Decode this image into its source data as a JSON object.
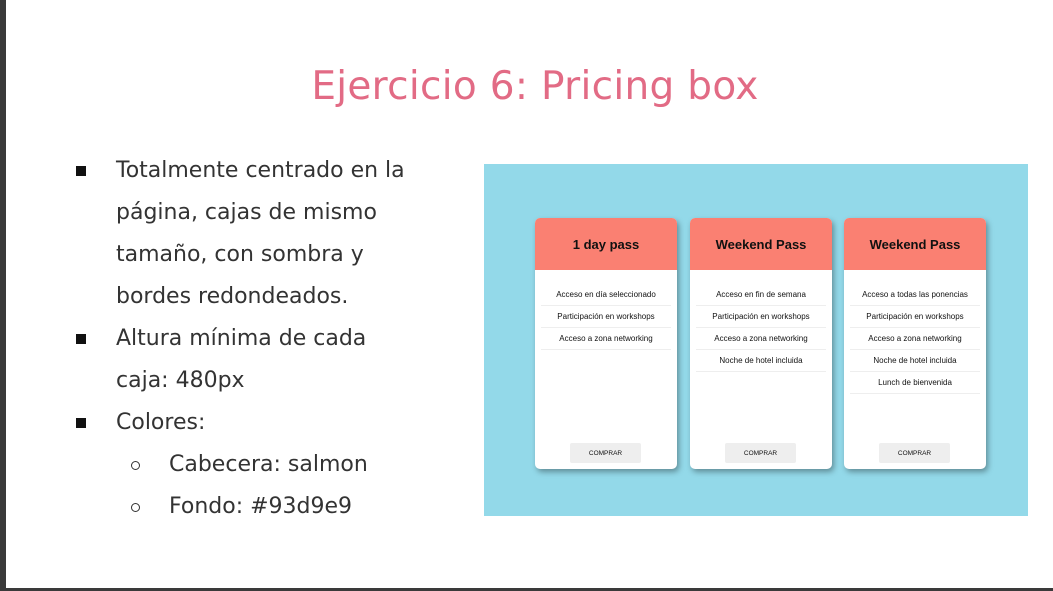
{
  "slide": {
    "title": "Ejercicio 6: Pricing box",
    "bullets": [
      {
        "lines": [
          "Totalmente centrado en la",
          "página, cajas de mismo",
          "tamaño, con sombra y",
          "bordes redondeados."
        ]
      },
      {
        "lines": [
          "Altura mínima de cada",
          "caja: 480px"
        ]
      },
      {
        "lines": [
          "Colores:"
        ]
      }
    ],
    "sub_bullets": [
      "Cabecera: salmon",
      "Fondo: #93d9e9"
    ]
  },
  "preview": {
    "background_color": "#93d9e9",
    "header_color": "#fa8072",
    "cards": [
      {
        "title": "1 day pass",
        "features": [
          "Acceso en día seleccionado",
          "Participación en workshops",
          "Acceso a zona networking"
        ],
        "button": "COMPRAR"
      },
      {
        "title": "Weekend Pass",
        "features": [
          "Acceso en fin de semana",
          "Participación en workshops",
          "Acceso a zona networking",
          "Noche de hotel incluida"
        ],
        "button": "COMPRAR"
      },
      {
        "title": "Weekend Pass",
        "features": [
          "Acceso a todas las ponencias",
          "Participación en workshops",
          "Acceso a zona networking",
          "Noche de hotel incluida",
          "Lunch de bienvenida"
        ],
        "button": "COMPRAR"
      }
    ]
  }
}
